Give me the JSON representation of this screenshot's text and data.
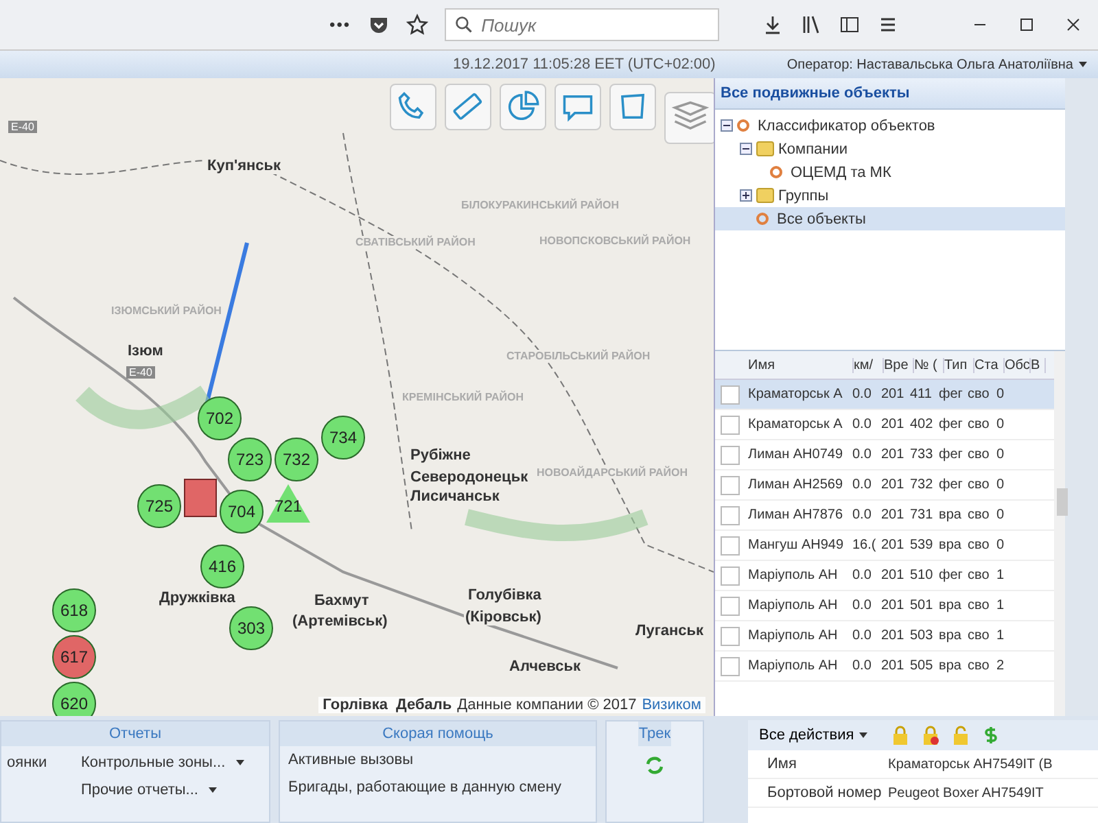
{
  "browser": {
    "more": "•••",
    "search": {
      "placeholder": "Пошук"
    }
  },
  "header": {
    "datetime": "19.12.2017 11:05:28 EET (UTC+02:00)",
    "operator": "Оператор: Наставальська Ольга Анатоліївна"
  },
  "map": {
    "cities": [
      {
        "label": "Куп'янськ",
        "kind": "city"
      },
      {
        "label": "Ізюм",
        "kind": "city"
      },
      {
        "label": "Рубіжне",
        "kind": "city"
      },
      {
        "label": "Северодонецьк",
        "kind": "city"
      },
      {
        "label": "Лисичанськ",
        "kind": "city"
      },
      {
        "label": "Дружківка",
        "kind": "city"
      },
      {
        "label": "Бахмут",
        "kind": "city"
      },
      {
        "label": "(Артемівськ)",
        "kind": "city"
      },
      {
        "label": "Голубівка",
        "kind": "city"
      },
      {
        "label": "(Кіровськ)",
        "kind": "city"
      },
      {
        "label": "Луганськ",
        "kind": "city"
      },
      {
        "label": "Алчевськ",
        "kind": "city"
      },
      {
        "label": "СВАТІВСЬКИЙ РАЙОН",
        "kind": "district"
      },
      {
        "label": "КРЕМІНСЬКИЙ РАЙОН",
        "kind": "district"
      },
      {
        "label": "СТАРОБІЛЬСЬКИЙ РАЙОН",
        "kind": "district"
      },
      {
        "label": "БІЛОКУРАКИНСЬКИЙ РАЙОН",
        "kind": "district"
      },
      {
        "label": "НОВОПСКОВСЬКИЙ РАЙОН",
        "kind": "district"
      },
      {
        "label": "ІЗЮМСЬКИЙ РАЙОН",
        "kind": "district"
      },
      {
        "label": "НОВОАЙДАРСЬКИЙ РАЙОН",
        "kind": "district"
      },
      {
        "label": "E-40",
        "kind": "road"
      },
      {
        "label": "E-40",
        "kind": "road"
      }
    ],
    "markers": [
      {
        "label": "702",
        "kind": "circle",
        "color": "#72e072"
      },
      {
        "label": "734",
        "kind": "circle",
        "color": "#72e072"
      },
      {
        "label": "732",
        "kind": "circle",
        "color": "#72e072"
      },
      {
        "label": "723",
        "kind": "circle",
        "color": "#72e072"
      },
      {
        "label": "725",
        "kind": "circle",
        "color": "#72e072"
      },
      {
        "kind": "square",
        "color": "#e06666"
      },
      {
        "label": "704",
        "kind": "circle",
        "color": "#72e072"
      },
      {
        "label": "721",
        "kind": "triangle",
        "color": "#72e072"
      },
      {
        "label": "416",
        "kind": "circle",
        "color": "#72e072"
      },
      {
        "label": "303",
        "kind": "circle",
        "color": "#72e072"
      },
      {
        "label": "618",
        "kind": "circle",
        "color": "#72e072"
      },
      {
        "label": "617",
        "kind": "circle",
        "color": "#e06666"
      },
      {
        "label": "620",
        "kind": "circle",
        "color": "#72e072"
      }
    ],
    "attribution": {
      "places": "Горлівка  Дебаль",
      "text": "Данные компании © 2017",
      "link": "Визиком"
    }
  },
  "panel": {
    "title": "Все подвижные объекты",
    "tree": [
      {
        "label": "Классификатор объектов",
        "kind": "search",
        "expanded": true,
        "selected": false,
        "children": [
          {
            "label": "Компании",
            "kind": "folder",
            "expanded": true,
            "selected": false,
            "children": [
              {
                "label": "ОЦЕМД та МК",
                "kind": "search",
                "selected": false
              }
            ]
          },
          {
            "label": "Группы",
            "kind": "folder",
            "expanded": false,
            "selected": false
          },
          {
            "label": "Все объекты",
            "kind": "search",
            "selected": true
          }
        ]
      }
    ]
  },
  "table": {
    "columns": [
      "Имя",
      "км/",
      "Вре",
      "№ (",
      "Тип",
      "Ста",
      "Обс",
      "В"
    ],
    "rows": [
      {
        "selected": true,
        "checked": false,
        "cells": [
          "Краматорськ А",
          "0.0",
          "201",
          "411",
          "фег",
          "сво",
          "0"
        ]
      },
      {
        "selected": false,
        "checked": false,
        "cells": [
          "Краматорськ А",
          "0.0",
          "201",
          "402",
          "фег",
          "сво",
          "0"
        ]
      },
      {
        "selected": false,
        "checked": false,
        "cells": [
          "Лиман АН0749",
          "0.0",
          "201",
          "733",
          "фег",
          "сво",
          "0"
        ]
      },
      {
        "selected": false,
        "checked": false,
        "cells": [
          "Лиман АН2569",
          "0.0",
          "201",
          "732",
          "фег",
          "сво",
          "0"
        ]
      },
      {
        "selected": false,
        "checked": false,
        "cells": [
          "Лиман АН7876",
          "0.0",
          "201",
          "731",
          "вра",
          "сво",
          "0"
        ]
      },
      {
        "selected": false,
        "checked": false,
        "cells": [
          "Мангуш АН949",
          "16.(",
          "201",
          "539",
          "вра",
          "сво",
          "0"
        ]
      },
      {
        "selected": false,
        "checked": false,
        "cells": [
          "Маріуполь АН",
          "0.0",
          "201",
          "510",
          "фег",
          "сво",
          "1"
        ]
      },
      {
        "selected": false,
        "checked": false,
        "cells": [
          "Маріуполь АН",
          "0.0",
          "201",
          "501",
          "вра",
          "сво",
          "1"
        ]
      },
      {
        "selected": false,
        "checked": false,
        "cells": [
          "Маріуполь АН",
          "0.0",
          "201",
          "503",
          "вра",
          "сво",
          "1"
        ]
      },
      {
        "selected": false,
        "checked": false,
        "cells": [
          "Маріуполь АН",
          "0.0",
          "201",
          "505",
          "вра",
          "сво",
          "2"
        ]
      }
    ]
  },
  "reports": {
    "title": "Отчеты",
    "items": [
      {
        "label": "оянки",
        "dropdown": false
      },
      {
        "label": "Контрольные зоны...",
        "dropdown": true
      },
      {
        "label": "Прочие отчеты...",
        "dropdown": true
      }
    ]
  },
  "ambulance": {
    "title": "Скорая помощь",
    "items": [
      "Активные вызовы",
      "Бригады, работающие в данную смену"
    ]
  },
  "track": {
    "title": "Трек"
  },
  "actions": {
    "label": "Все действия"
  },
  "properties": [
    {
      "name": "Имя",
      "value": "Краматорськ АН7549IT (В"
    },
    {
      "name": "Бортовой номер",
      "value": "Peugeot Boxer AH7549IT"
    }
  ]
}
